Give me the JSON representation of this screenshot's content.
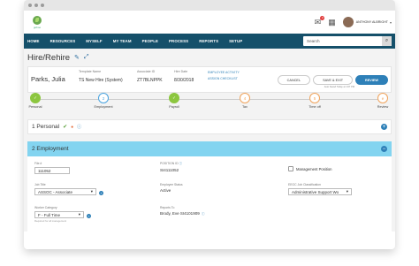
{
  "topbar": {
    "logo_text": "goboo",
    "username": "ANTHONY ALBRIGHT",
    "mail_badge": "3"
  },
  "nav": {
    "items": [
      "HOME",
      "RESOURCES",
      "MYSELF",
      "MY TEAM",
      "PEOPLE",
      "PROCESS",
      "REPORTS",
      "SETUP"
    ],
    "search_placeholder": "Search"
  },
  "page": {
    "title": "Hire/Rehire"
  },
  "employee": {
    "name": "Parks, Julia",
    "template_label": "Template Name",
    "template_value": "TS New Hire (System)",
    "associate_label": "Associate ID",
    "associate_value": "ZT7BLNPPK",
    "hire_label": "Hire Date",
    "hire_value": "8/30/2018",
    "link_activity": "EMPLOYEE ACTIVITY",
    "link_checklist": "ASSIGN CHECKLIST",
    "cancel_label": "CANCEL",
    "save_exit_label": "SAVE & EXIT",
    "review_label": "REVIEW",
    "autosave_text": "Auto Saved Today at 1:07 PM"
  },
  "steps": [
    {
      "num": "✓",
      "label": "Personal",
      "state": "done"
    },
    {
      "num": "2",
      "label": "Employment",
      "state": "current"
    },
    {
      "num": "✓",
      "label": "Payroll",
      "state": "done"
    },
    {
      "num": "4",
      "label": "Tax",
      "state": "pending"
    },
    {
      "num": "5",
      "label": "Time off",
      "state": "pending"
    },
    {
      "num": "e",
      "label": "Review",
      "state": "pending"
    }
  ],
  "sections": {
    "personal": "1 Personal",
    "employment": "2 Employment"
  },
  "form": {
    "file_label": "File #",
    "file_value": "111052",
    "position_label": "POSITION ID",
    "position_value": "SI4111052",
    "management_label": "Management Position",
    "jobtitle_label": "Job Title",
    "jobtitle_value": "ASSOC - Associate",
    "status_label": "Employee Status",
    "status_value": "Active",
    "eeoc_label": "EEOC Job Classification",
    "eeoc_value": "Administrative Support Wo",
    "worker_label": "Worker Category",
    "worker_value": "F - Full Time",
    "worker_hint": "Required for all management",
    "reports_label": "Reports To",
    "reports_value": "Brody, Eve SI4101909"
  }
}
